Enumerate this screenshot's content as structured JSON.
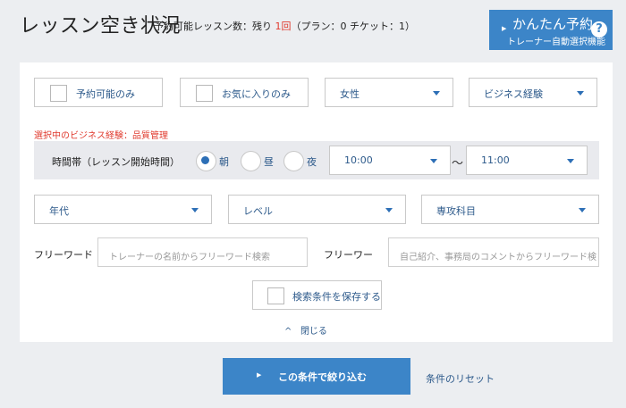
{
  "header": {
    "title": "レッスン空き状況",
    "remaining_prefix": "予約可能レッスン数：残り ",
    "remaining_count": "1回",
    "remaining_suffix": "（プラン：0 チケット：1）"
  },
  "easy_booking": {
    "arrow": "▶",
    "label": "かんたん予約",
    "sub_label": "トレーナー自動選択機能",
    "help": "?"
  },
  "filters": {
    "available_only": "予約可能のみ",
    "favorites_only": "お気に入りのみ",
    "gender": "女性",
    "experience": "ビジネス経験"
  },
  "notice": "選択中のビジネス経験：品質管理",
  "time": {
    "label": "時間帯（レッスン開始時間）",
    "options": [
      "朝",
      "昼",
      "夜"
    ],
    "selected": "朝",
    "start": "10:00",
    "tilde": "〜",
    "end": "11:00"
  },
  "selects": {
    "age": "年代",
    "level": "レベル",
    "major": "専攻科目"
  },
  "freeword": {
    "label1": "フリーワード",
    "placeholder1": "トレーナーの名前からフリーワード検索",
    "label2": "フリーワー",
    "placeholder2": "自己紹介、事務局のコメントからフリーワード検"
  },
  "save_conditions": "検索条件を保存する",
  "close": {
    "icon": "^",
    "label": "閉じる"
  },
  "actions": {
    "arrow": "▶",
    "filter": "この条件で絞り込む",
    "reset": "条件のリセット"
  },
  "colors": {
    "accent": "#3c85c8",
    "alert": "#e03b2f",
    "background": "#eceef1"
  }
}
